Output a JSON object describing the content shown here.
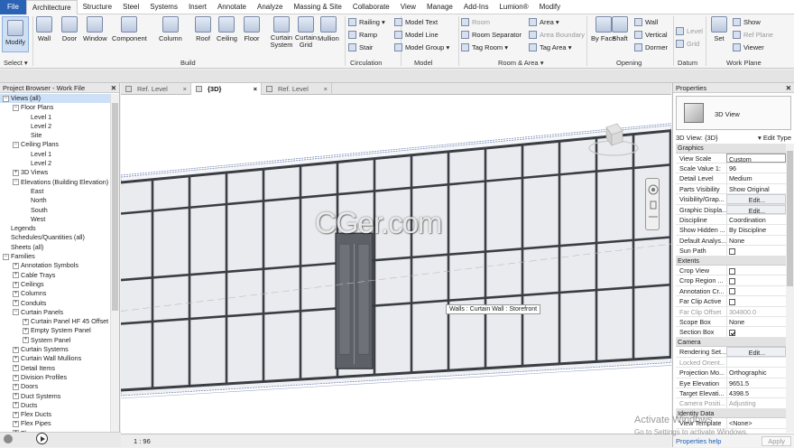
{
  "menu": [
    "File",
    "Architecture",
    "Structure",
    "Steel",
    "Systems",
    "Insert",
    "Annotate",
    "Analyze",
    "Massing & Site",
    "Collaborate",
    "View",
    "Manage",
    "Add-Ins",
    "Lumion®",
    "Modify"
  ],
  "menu_active": "Architecture",
  "ribbon": {
    "select_label": "Select ▾",
    "modify": "Modify",
    "build_buttons": [
      "Wall",
      "Door",
      "Window",
      "Component",
      "Column",
      "Roof",
      "Ceiling",
      "Floor",
      "Curtain System",
      "Curtain Grid",
      "Mullion"
    ],
    "circulation": [
      "Railing ▾",
      "Ramp",
      "Stair"
    ],
    "model": [
      "Model Text",
      "Model Line",
      "Model Group ▾"
    ],
    "room_area": [
      "Room",
      "Room Separator",
      "Tag Room ▾",
      "Area ▾",
      "Area Boundary",
      "Tag Area ▾"
    ],
    "opening": [
      "By Face",
      "Shaft",
      "Wall",
      "Vertical",
      "Dormer"
    ],
    "datum": [
      "Level",
      "Grid"
    ],
    "work_plane": [
      "Set",
      "Show",
      "Ref Plane",
      "Viewer"
    ],
    "groups": [
      "Build",
      "Circulation",
      "Model",
      "Room & Area ▾",
      "Opening",
      "Datum",
      "Work Plane"
    ]
  },
  "project_browser": {
    "title": "Project Browser - Work File",
    "tree": [
      {
        "label": "Views (all)",
        "level": 0,
        "toggle": "−",
        "sel": true
      },
      {
        "label": "Floor Plans",
        "level": 1,
        "toggle": "−"
      },
      {
        "label": "Level 1",
        "level": 2,
        "toggle": ""
      },
      {
        "label": "Level 2",
        "level": 2,
        "toggle": ""
      },
      {
        "label": "Site",
        "level": 2,
        "toggle": ""
      },
      {
        "label": "Ceiling Plans",
        "level": 1,
        "toggle": "−"
      },
      {
        "label": "Level 1",
        "level": 2,
        "toggle": ""
      },
      {
        "label": "Level 2",
        "level": 2,
        "toggle": ""
      },
      {
        "label": "3D Views",
        "level": 1,
        "toggle": "+"
      },
      {
        "label": "Elevations (Building Elevation)",
        "level": 1,
        "toggle": "−"
      },
      {
        "label": "East",
        "level": 2,
        "toggle": ""
      },
      {
        "label": "North",
        "level": 2,
        "toggle": ""
      },
      {
        "label": "South",
        "level": 2,
        "toggle": ""
      },
      {
        "label": "West",
        "level": 2,
        "toggle": ""
      },
      {
        "label": "Legends",
        "level": 0,
        "toggle": ""
      },
      {
        "label": "Schedules/Quantities (all)",
        "level": 0,
        "toggle": ""
      },
      {
        "label": "Sheets (all)",
        "level": 0,
        "toggle": ""
      },
      {
        "label": "Families",
        "level": 0,
        "toggle": "−"
      },
      {
        "label": "Annotation Symbols",
        "level": 1,
        "toggle": "+"
      },
      {
        "label": "Cable Trays",
        "level": 1,
        "toggle": "+"
      },
      {
        "label": "Ceilings",
        "level": 1,
        "toggle": "+"
      },
      {
        "label": "Columns",
        "level": 1,
        "toggle": "+"
      },
      {
        "label": "Conduits",
        "level": 1,
        "toggle": "+"
      },
      {
        "label": "Curtain Panels",
        "level": 1,
        "toggle": "−"
      },
      {
        "label": "Curtain Panel HF 45 Offset",
        "level": 2,
        "toggle": "+"
      },
      {
        "label": "Empty System Panel",
        "level": 2,
        "toggle": "+"
      },
      {
        "label": "System Panel",
        "level": 2,
        "toggle": "+"
      },
      {
        "label": "Curtain Systems",
        "level": 1,
        "toggle": "+"
      },
      {
        "label": "Curtain Wall Mullions",
        "level": 1,
        "toggle": "+"
      },
      {
        "label": "Detail Items",
        "level": 1,
        "toggle": "+"
      },
      {
        "label": "Division Profiles",
        "level": 1,
        "toggle": "+"
      },
      {
        "label": "Doors",
        "level": 1,
        "toggle": "+"
      },
      {
        "label": "Duct Systems",
        "level": 1,
        "toggle": "+"
      },
      {
        "label": "Ducts",
        "level": 1,
        "toggle": "+"
      },
      {
        "label": "Flex Ducts",
        "level": 1,
        "toggle": "+"
      },
      {
        "label": "Flex Pipes",
        "level": 1,
        "toggle": "+"
      },
      {
        "label": "Floors",
        "level": 1,
        "toggle": "+"
      }
    ]
  },
  "tabs": [
    {
      "label": "Ref. Level",
      "active": false
    },
    {
      "label": "{3D}",
      "active": true
    },
    {
      "label": "Ref. Level",
      "active": false
    }
  ],
  "tooltip": "Walls : Curtain Wall : Storefront",
  "watermark": "CGer.com",
  "status_scale": "1 : 96",
  "activate_windows": {
    "line1": "Activate Windows",
    "line2": "Go to Settings to activate Windows."
  },
  "properties": {
    "title": "Properties",
    "type_name": "3D View",
    "view_label": "3D View: {3D}",
    "edit_type": "Edit Type",
    "sections": [
      {
        "name": "Graphics",
        "rows": [
          {
            "n": "View Scale",
            "v": "Custom",
            "kind": "box"
          },
          {
            "n": "Scale Value 1:",
            "v": "96"
          },
          {
            "n": "Detail Level",
            "v": "Medium"
          },
          {
            "n": "Parts Visibility",
            "v": "Show Original"
          },
          {
            "n": "Visibility/Grap...",
            "v": "Edit...",
            "kind": "btn"
          },
          {
            "n": "Graphic Displa...",
            "v": "Edit...",
            "kind": "btn"
          },
          {
            "n": "Discipline",
            "v": "Coordination"
          },
          {
            "n": "Show Hidden ...",
            "v": "By Discipline"
          },
          {
            "n": "Default Analys...",
            "v": "None"
          },
          {
            "n": "Sun Path",
            "v": "",
            "kind": "chk"
          }
        ]
      },
      {
        "name": "Extents",
        "rows": [
          {
            "n": "Crop View",
            "v": "",
            "kind": "chk"
          },
          {
            "n": "Crop Region ...",
            "v": "",
            "kind": "chk"
          },
          {
            "n": "Annotation Cr...",
            "v": "",
            "kind": "chk"
          },
          {
            "n": "Far Clip Active",
            "v": "",
            "kind": "chk"
          },
          {
            "n": "Far Clip Offset",
            "v": "304800.0",
            "kind": "dis"
          },
          {
            "n": "Scope Box",
            "v": "None"
          },
          {
            "n": "Section Box",
            "v": "",
            "kind": "chkon"
          }
        ]
      },
      {
        "name": "Camera",
        "rows": [
          {
            "n": "Rendering Set...",
            "v": "Edit...",
            "kind": "btn"
          },
          {
            "n": "Locked Orient...",
            "v": "",
            "kind": "dis"
          },
          {
            "n": "Projection Mo...",
            "v": "Orthographic"
          },
          {
            "n": "Eye Elevation",
            "v": "9651.5"
          },
          {
            "n": "Target Elevati...",
            "v": "4398.5"
          },
          {
            "n": "Camera Positi...",
            "v": "Adjusting",
            "kind": "dis"
          }
        ]
      },
      {
        "name": "Identity Data",
        "rows": [
          {
            "n": "View Template",
            "v": "<None>"
          }
        ]
      }
    ],
    "help": "Properties help",
    "apply": "Apply"
  },
  "colors": {
    "accent": "#2a62b6",
    "mullion": "#3a3e44",
    "glass": "#e9ebee",
    "door": "#5d6066"
  }
}
